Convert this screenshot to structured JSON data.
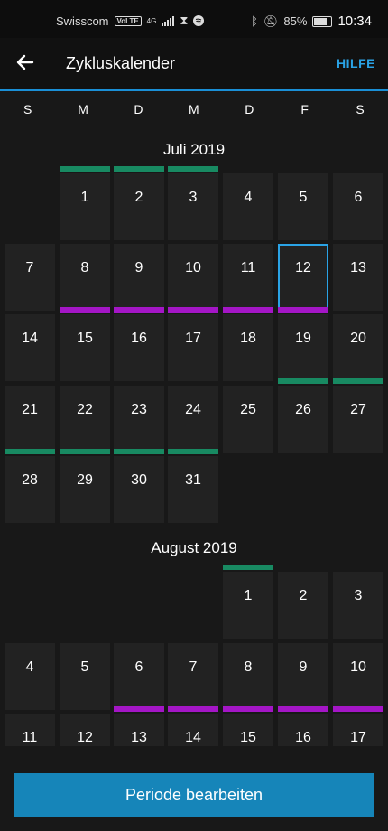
{
  "status": {
    "carrier": "Swisscom",
    "volte": "VoLTE",
    "network": "4G",
    "battery": "85%",
    "time": "10:34"
  },
  "header": {
    "title": "Zykluskalender",
    "help_label": "HILFE"
  },
  "weekdays": [
    "S",
    "M",
    "D",
    "M",
    "D",
    "F",
    "S"
  ],
  "months": [
    {
      "title": "Juli 2019",
      "days": [
        "1",
        "2",
        "3",
        "4",
        "5",
        "6",
        "7",
        "8",
        "9",
        "10",
        "11",
        "12",
        "13",
        "14",
        "15",
        "16",
        "17",
        "18",
        "19",
        "20",
        "21",
        "22",
        "23",
        "24",
        "25",
        "26",
        "27",
        "28",
        "29",
        "30",
        "31"
      ],
      "today": "12",
      "green": [
        "1",
        "2",
        "3",
        "26",
        "27",
        "28",
        "29",
        "30",
        "31"
      ],
      "purple": [
        "15",
        "16",
        "17",
        "18",
        "19"
      ]
    },
    {
      "title": "August 2019",
      "days": [
        "1",
        "2",
        "3",
        "4",
        "5",
        "6",
        "7",
        "8",
        "9",
        "10",
        "11",
        "12",
        "13",
        "14",
        "15",
        "16",
        "17"
      ],
      "green": [
        "1"
      ],
      "purple": [
        "13",
        "14",
        "15",
        "16",
        "17"
      ]
    }
  ],
  "colors": {
    "accent": "#2aa3e6",
    "fertile": "#188a62",
    "period": "#a416c6",
    "button": "#1685b9"
  },
  "action": {
    "label": "Periode bearbeiten"
  }
}
